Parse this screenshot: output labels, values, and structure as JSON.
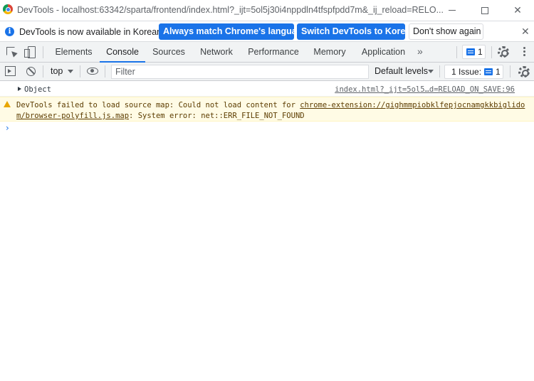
{
  "window": {
    "title": "DevTools - localhost:63342/sparta/frontend/index.html?_ijt=5ol5j30i4nppdln4tfspfpdd7m&_ij_reload=RELO..."
  },
  "infobar": {
    "message": "DevTools is now available in Korean!",
    "match_button": "Always match Chrome's language",
    "switch_button": "Switch DevTools to Korean",
    "dismiss_button": "Don't show again",
    "close_glyph": "✕"
  },
  "tabs": [
    {
      "label": "Elements"
    },
    {
      "label": "Console"
    },
    {
      "label": "Sources"
    },
    {
      "label": "Network"
    },
    {
      "label": "Performance"
    },
    {
      "label": "Memory"
    },
    {
      "label": "Application"
    }
  ],
  "active_tab": "Console",
  "more_tabs_glyph": "»",
  "issues_count": "1",
  "console_toolbar": {
    "context": "top",
    "filter_placeholder": "Filter",
    "levels": "Default levels",
    "issue_label": "1 Issue:",
    "issue_count": "1"
  },
  "messages": {
    "object_label": "Object",
    "object_source": "index.html?_ijt=5ol5…d=RELOAD_ON_SAVE:96",
    "warning_prefix": "DevTools failed to load source map: Could not load content for ",
    "warning_link": "chrome-extension://gighmmpiobklfepjocnamgkkbiglidom/browser-polyfill.js.map",
    "warning_suffix": ": System error: net::ERR_FILE_NOT_FOUND"
  },
  "prompt_glyph": "›",
  "colors": {
    "accent": "#1a73e8",
    "warning_bg": "#fffbe5",
    "warning_text": "#5c3c00",
    "warning_icon": "#e8a600",
    "toolbar_bg": "#f1f3f4"
  },
  "icons": [
    "chrome-logo-icon",
    "info-icon",
    "inspect-icon",
    "device-toggle-icon",
    "message-icon",
    "gear-icon",
    "kebab-menu-icon",
    "sidebar-toggle-icon",
    "clear-console-icon",
    "eye-icon",
    "warning-icon",
    "expand-arrow-icon"
  ]
}
